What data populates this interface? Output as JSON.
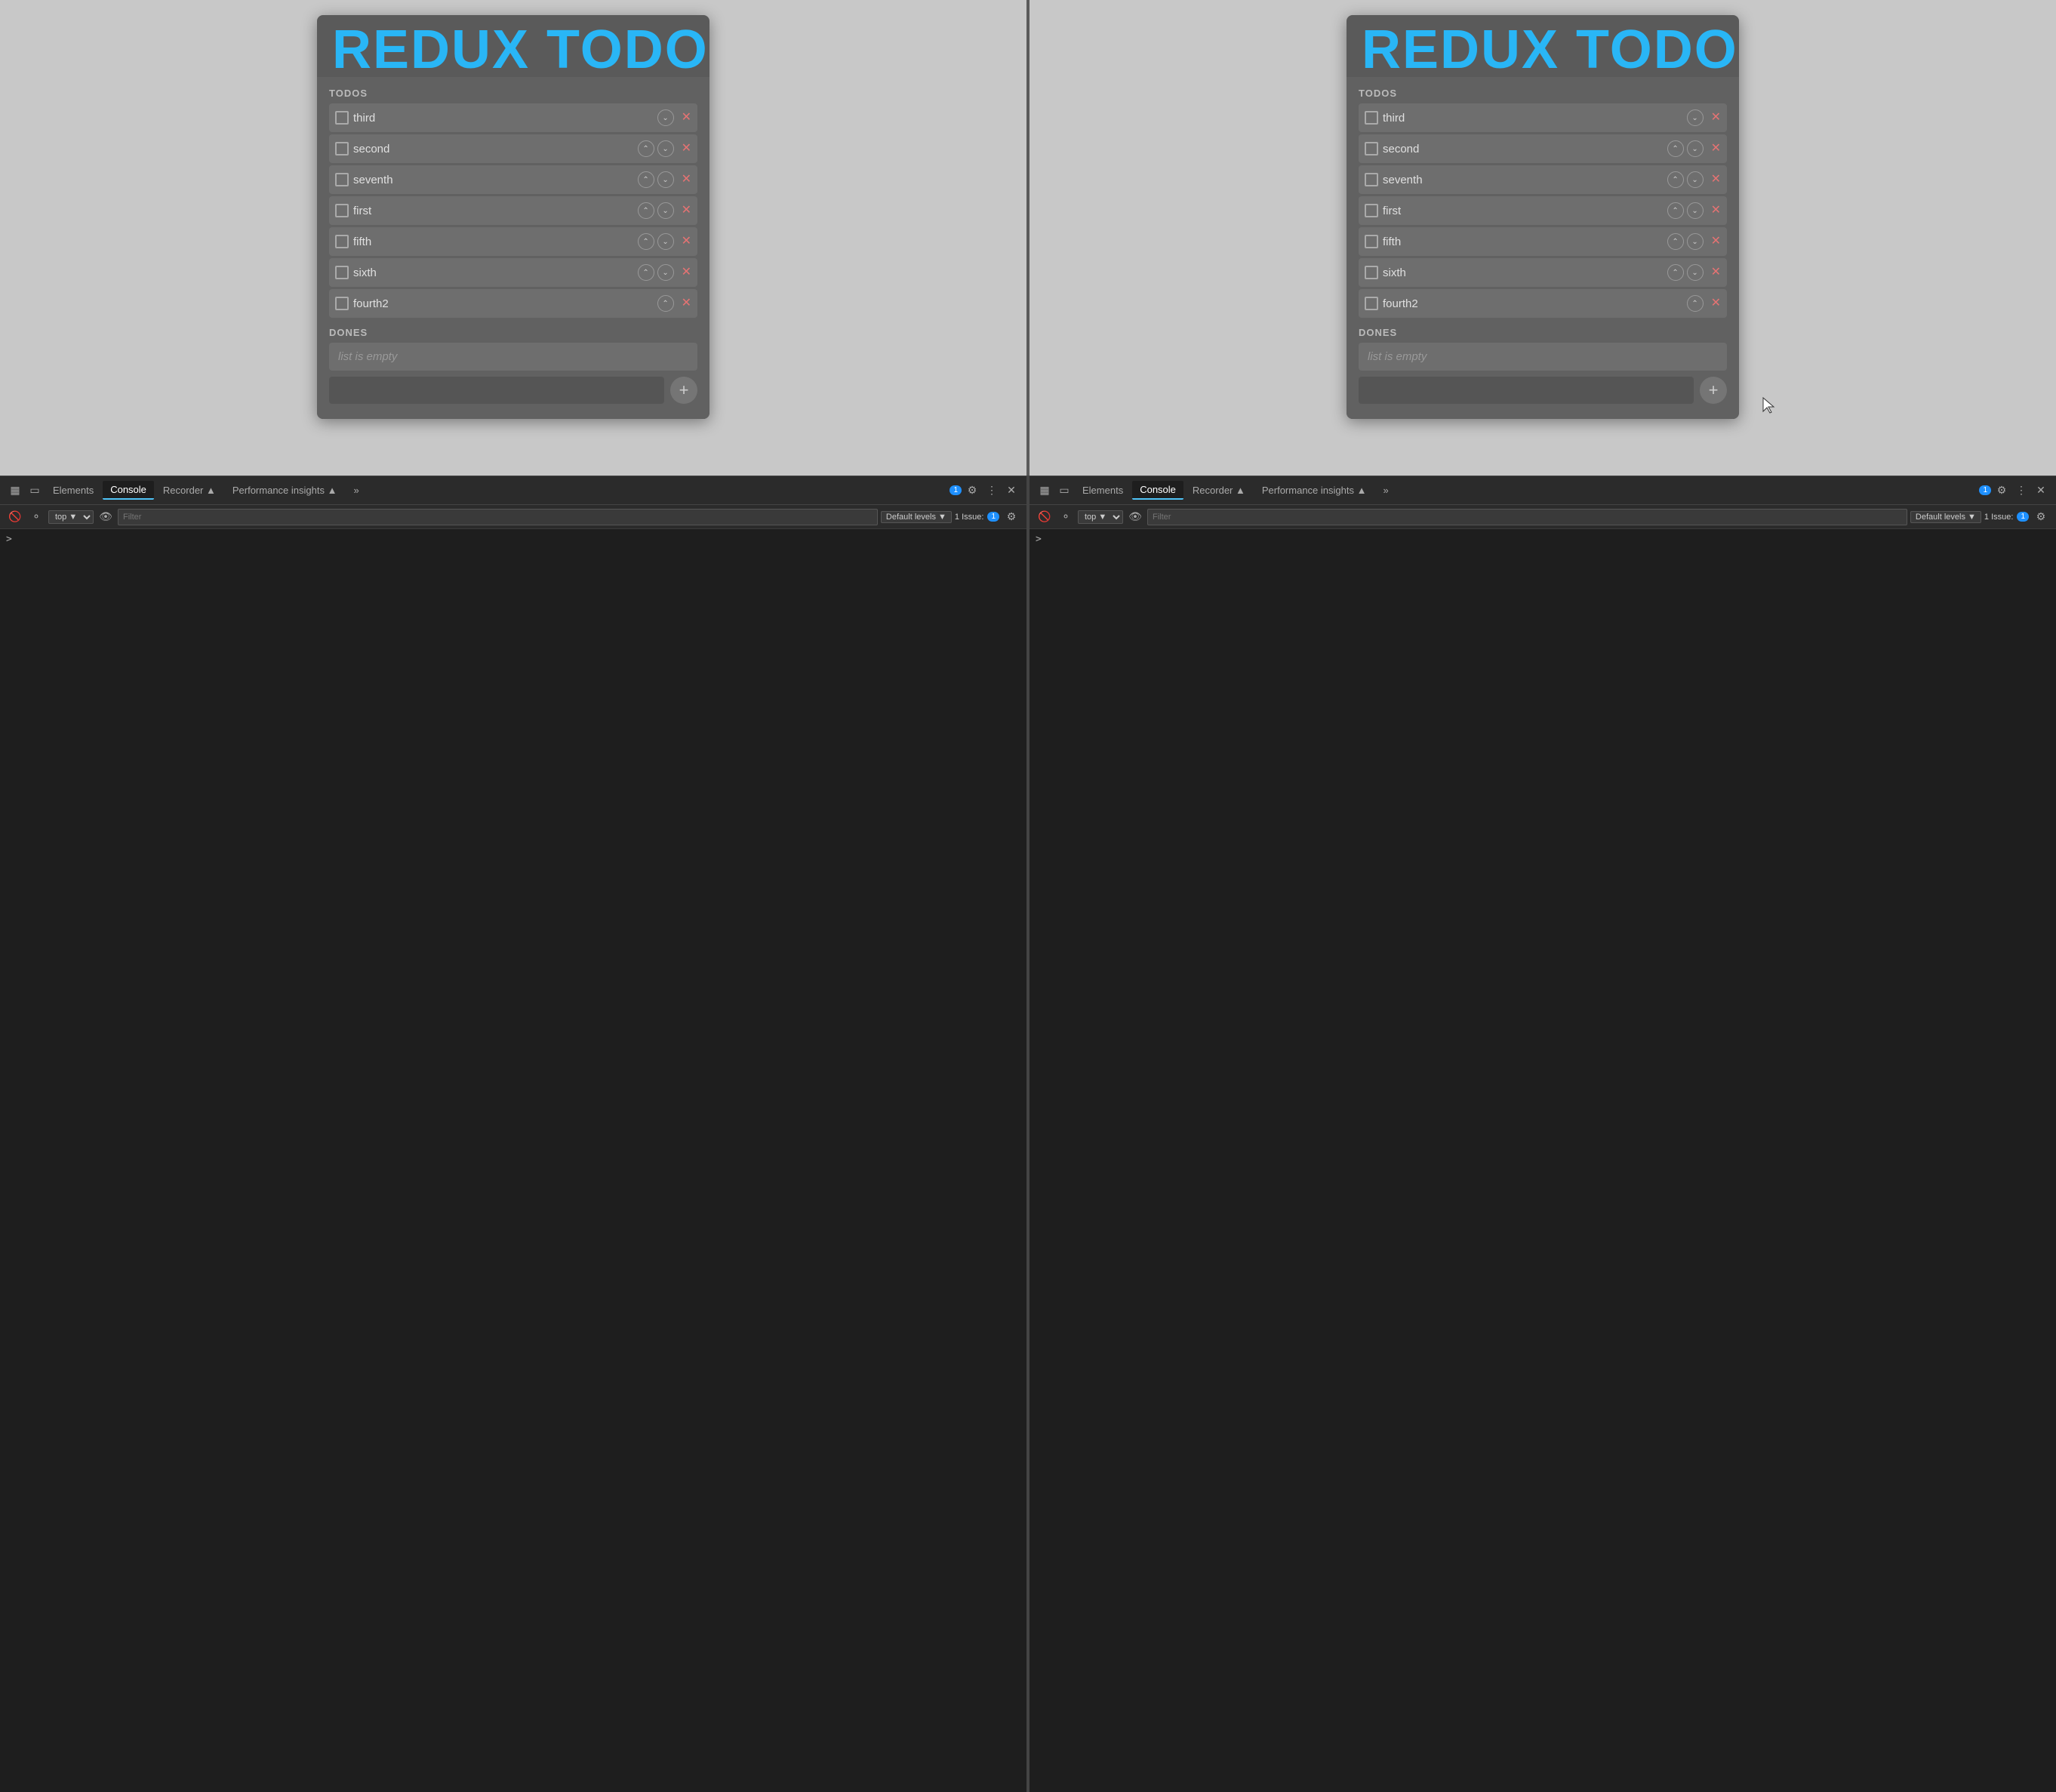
{
  "panels": [
    {
      "id": "left",
      "title": "REDUX TODO",
      "todos_label": "TODOS",
      "dones_label": "DONES",
      "todos": [
        {
          "text": "third",
          "hasUp": false,
          "hasDown": true
        },
        {
          "text": "second",
          "hasUp": true,
          "hasDown": true
        },
        {
          "text": "seventh",
          "hasUp": true,
          "hasDown": true
        },
        {
          "text": "first",
          "hasUp": true,
          "hasDown": true
        },
        {
          "text": "fifth",
          "hasUp": true,
          "hasDown": true
        },
        {
          "text": "sixth",
          "hasUp": true,
          "hasDown": true
        },
        {
          "text": "fourth2",
          "hasUp": true,
          "hasDown": false
        }
      ],
      "dones_empty": "list is empty"
    },
    {
      "id": "right",
      "title": "REDUX TODO",
      "todos_label": "TODOS",
      "dones_label": "DONES",
      "todos": [
        {
          "text": "third",
          "hasUp": false,
          "hasDown": true
        },
        {
          "text": "second",
          "hasUp": true,
          "hasDown": true
        },
        {
          "text": "seventh",
          "hasUp": true,
          "hasDown": true
        },
        {
          "text": "first",
          "hasUp": true,
          "hasDown": true
        },
        {
          "text": "fifth",
          "hasUp": true,
          "hasDown": true
        },
        {
          "text": "sixth",
          "hasUp": true,
          "hasDown": true
        },
        {
          "text": "fourth2",
          "hasUp": true,
          "hasDown": false
        }
      ],
      "dones_empty": "list is empty"
    }
  ],
  "devtools": [
    {
      "id": "left",
      "tabs": [
        "Elements",
        "Console",
        "Recorder ▲",
        "Performance insights ▲",
        "»"
      ],
      "active_tab": "Console",
      "badge": "1",
      "console_filter_placeholder": "Filter",
      "levels_label": "Default levels ▼",
      "top_label": "top ▼",
      "issue_label": "1 Issue:",
      "issue_badge": "1"
    },
    {
      "id": "right",
      "tabs": [
        "Elements",
        "Console",
        "Recorder ▲",
        "Performance insights ▲",
        "»"
      ],
      "active_tab": "Console",
      "badge": "1",
      "console_filter_placeholder": "Filter",
      "levels_label": "Default levels ▼",
      "top_label": "top ▼",
      "issue_label": "1 Issue:",
      "issue_badge": "1"
    }
  ],
  "cursor": {
    "visible": true
  }
}
